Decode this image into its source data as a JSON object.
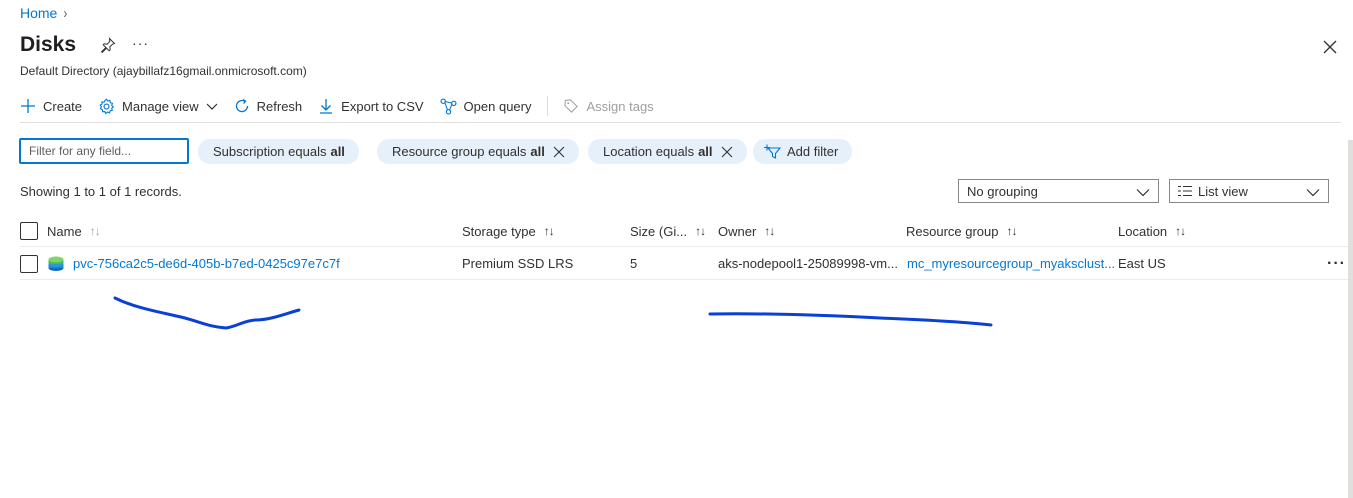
{
  "breadcrumb": {
    "home": "Home"
  },
  "header": {
    "title": "Disks",
    "more": "···",
    "subtitle": "Default Directory (ajaybillafz16gmail.onmicrosoft.com)"
  },
  "toolbar": {
    "create": "Create",
    "manage_view": "Manage view",
    "refresh": "Refresh",
    "export_csv": "Export to CSV",
    "open_query": "Open query",
    "assign_tags": "Assign tags"
  },
  "filters": {
    "placeholder": "Filter for any field...",
    "subscription": {
      "label": "Subscription equals",
      "value": "all"
    },
    "resource_group": {
      "label": "Resource group equals",
      "value": "all"
    },
    "location": {
      "label": "Location equals",
      "value": "all"
    },
    "add_filter": "Add filter"
  },
  "records_text": "Showing 1 to 1 of 1 records.",
  "grouping": {
    "selected": "No grouping"
  },
  "view": {
    "selected": "List view"
  },
  "table": {
    "columns": [
      {
        "label": "Name"
      },
      {
        "label": "Storage type"
      },
      {
        "label": "Size (Gi..."
      },
      {
        "label": "Owner"
      },
      {
        "label": "Resource group"
      },
      {
        "label": "Location"
      }
    ],
    "rows": [
      {
        "name": "pvc-756ca2c5-de6d-405b-b7ed-0425c97e7c7f",
        "storage_type": "Premium SSD LRS",
        "size": "5",
        "owner": "aks-nodepool1-25089998-vm...",
        "resource_group": "mc_myresourcegroup_myaksclust...",
        "location": "East US"
      }
    ]
  },
  "colors": {
    "accent": "#0078d4",
    "pill_bg": "#e6f0fb",
    "annotation": "#0a3fd8"
  }
}
